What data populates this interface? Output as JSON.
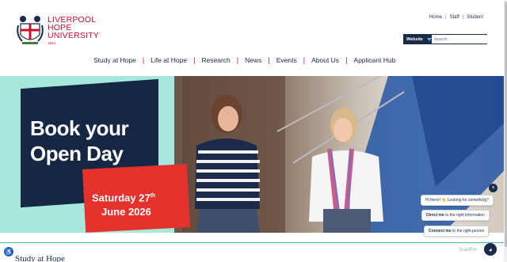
{
  "brand": {
    "line1": "LIVERPOOL",
    "line2": "HOPE",
    "line3": "UNIVERSITY",
    "year": "1844",
    "color": "#c8102e"
  },
  "top_links": [
    "Home",
    "Staff",
    "Student"
  ],
  "search": {
    "scope": "Website",
    "placeholder": "search"
  },
  "nav": [
    "Study at Hope",
    "Life at Hope",
    "Research",
    "News",
    "Events",
    "About Us",
    "Applicant Hub"
  ],
  "hero": {
    "headline_line1": "Book your",
    "headline_line2": "Open Day",
    "date_line1": "Saturday 27",
    "date_sup": "th",
    "date_line2": "June 2026",
    "colors": {
      "mint": "#a6e9dc",
      "navy": "#152742",
      "red": "#e5322d"
    }
  },
  "chat": {
    "close": "×",
    "greeting": "Hi there! 👋 Looking for something?",
    "option1_bold": "Direct me",
    "option1_rest": " to the right information",
    "option2_bold": "Connect me",
    "option2_rest": " to the right person",
    "avatar_icon": "chat-avatar-icon"
  },
  "footer": {
    "section_title": "Study at Hope",
    "scanpro": "ScanPro"
  }
}
